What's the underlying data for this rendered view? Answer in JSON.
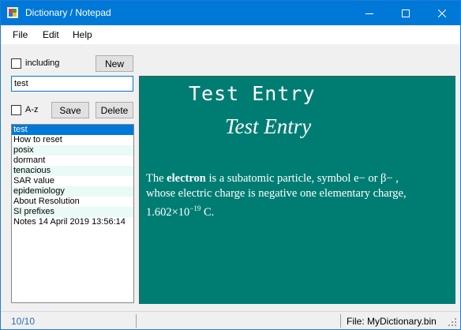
{
  "window": {
    "title": "Dictionary / Notepad"
  },
  "menu": {
    "file": "File",
    "edit": "Edit",
    "help": "Help"
  },
  "controls": {
    "including_label": "including",
    "new_label": "New",
    "search_value": "test",
    "az_label": "A-z",
    "save_label": "Save",
    "delete_label": "Delete"
  },
  "list": {
    "items": [
      "test",
      "How to reset",
      "posix",
      "dormant",
      "tenacious",
      "SAR value",
      "epidemiology",
      "About Resolution",
      "SI prefixes",
      "Notes  14 April 2019 13:56:14"
    ],
    "selected_index": 0
  },
  "entry": {
    "heading_mono": "Test Entry",
    "heading_serif": "Test Entry",
    "p_the": "The ",
    "p_term": "electron",
    "p_rest1": " is a subatomic particle, symbol e−  or  β− ,",
    "p_line2": "whose electric charge is negative one elementary charge,",
    "p_value": "1.602×10",
    "p_exp": "−19",
    "p_unit": " C."
  },
  "status": {
    "count": "10/10",
    "file": "File: MyDictionary.bin"
  },
  "colors": {
    "titlebar": "#0078d7",
    "display_bg": "#007d73",
    "selection": "#0078d7",
    "alt_row": "#eafaf6"
  }
}
